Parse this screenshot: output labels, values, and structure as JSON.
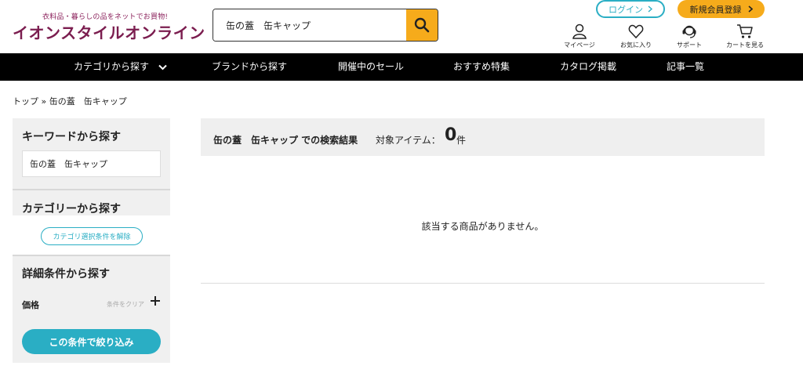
{
  "header": {
    "logo_tagline": "衣料品・暮らしの品をネットでお買物!",
    "logo_name": "イオンスタイルオンライン",
    "search_value": "缶の蓋　缶キャップ",
    "login_label": "ログイン",
    "register_label": "新規会員登録",
    "icons": [
      {
        "name": "user-icon",
        "label": "マイページ"
      },
      {
        "name": "heart-icon",
        "label": "お気に入り"
      },
      {
        "name": "support-icon",
        "label": "サポート"
      },
      {
        "name": "cart-icon",
        "label": "カートを見る"
      }
    ]
  },
  "nav": {
    "items": [
      "カテゴリから探す",
      "ブランドから探す",
      "開催中のセール",
      "おすすめ特集",
      "カタログ掲載",
      "記事一覧"
    ]
  },
  "breadcrumb": {
    "home": "トップ",
    "separator": "»",
    "current": "缶の蓋　缶キャップ"
  },
  "sidebar": {
    "keyword_heading": "キーワードから探す",
    "keyword_value": "缶の蓋　缶キャップ",
    "category_heading": "カテゴリーから探す",
    "clear_category_label": "カテゴリ選択条件を解除",
    "detail_heading": "詳細条件から探す",
    "price_label": "価格",
    "price_clear_label": "条件をクリア",
    "apply_label": "この条件で絞り込み"
  },
  "results": {
    "query_label": "缶の蓋　缶キャップ での検索結果",
    "count_label": "対象アイテム：",
    "count": "0",
    "count_unit": "件",
    "empty_message": "該当する商品がありません。"
  },
  "colors": {
    "brand": "#7b1d4f",
    "accent_teal": "#2aaec4",
    "accent_orange": "#f6ab1b",
    "nav_bg": "#000000"
  }
}
